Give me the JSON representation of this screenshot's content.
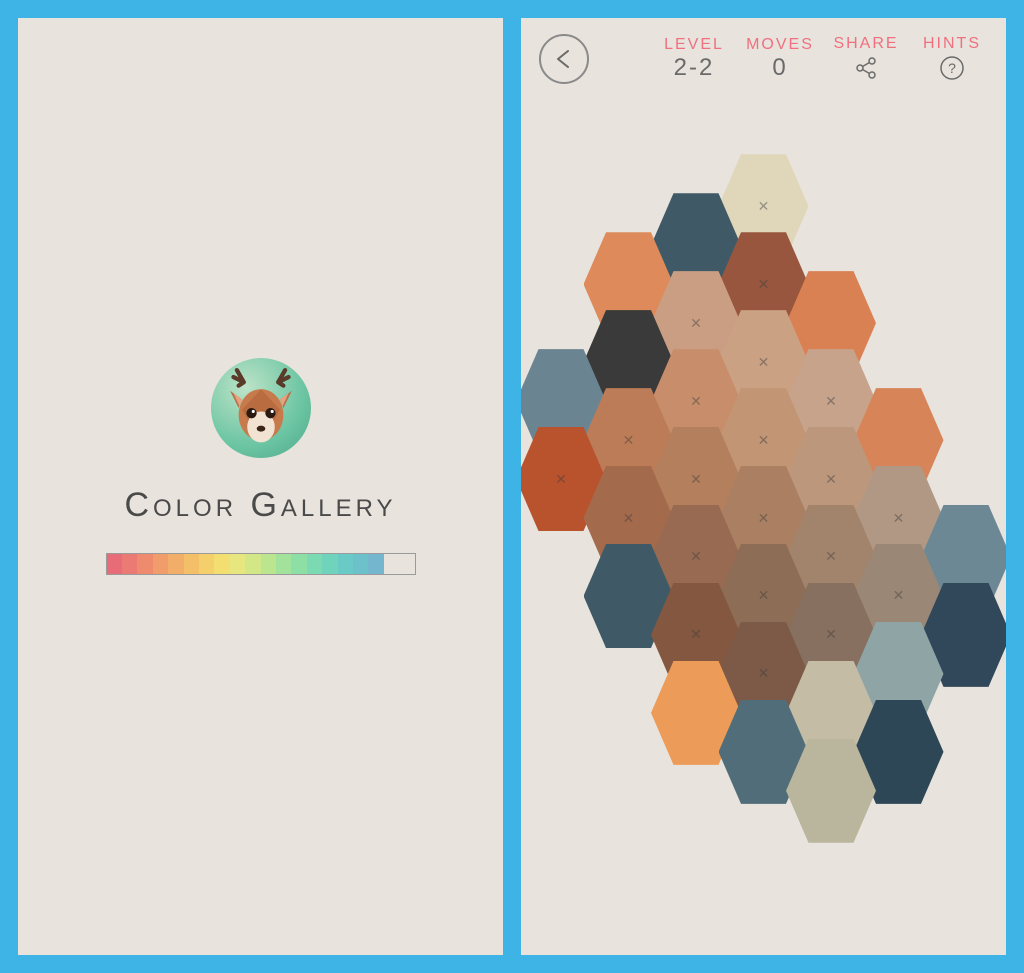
{
  "left": {
    "title": "Color Gallery",
    "avatar": "deer-icon",
    "progress_colors": [
      "#e86b78",
      "#ea7a73",
      "#ee8b6e",
      "#f09d6b",
      "#f2ae69",
      "#f4bf69",
      "#f5cf6b",
      "#f3de72",
      "#e8e67e",
      "#d3e786",
      "#bbe58f",
      "#a3e29a",
      "#8edfa6",
      "#7cdab2",
      "#70d4bd",
      "#6acbc6",
      "#6cc1cb",
      "#74b6cd",
      "#e8e3dc",
      "#e8e3dc"
    ]
  },
  "game": {
    "header": {
      "level_label": "LEVEL",
      "level_value": "2-2",
      "moves_label": "MOVES",
      "moves_value": "0",
      "share_label": "SHARE",
      "hints_label": "HINTS"
    },
    "hexes": [
      {
        "q": 0,
        "r": -4,
        "color": "#e0d7bb",
        "x": true
      },
      {
        "q": -1,
        "r": -3,
        "color": "#3f5a66",
        "x": false
      },
      {
        "q": 0,
        "r": -3,
        "color": "#97563d",
        "x": true
      },
      {
        "q": 1,
        "r": -3,
        "color": "#da8154",
        "x": false
      },
      {
        "q": -2,
        "r": -2,
        "color": "#de8a5a",
        "x": false
      },
      {
        "q": -1,
        "r": -2,
        "color": "#ca9e83",
        "x": true
      },
      {
        "q": 0,
        "r": -2,
        "color": "#cba184",
        "x": true
      },
      {
        "q": 1,
        "r": -2,
        "color": "#c7a38b",
        "x": true
      },
      {
        "q": 2,
        "r": -2,
        "color": "#d78458",
        "x": false
      },
      {
        "q": -2,
        "r": -1,
        "color": "#3a3a3a",
        "x": false
      },
      {
        "q": -1,
        "r": -1,
        "color": "#c88e6c",
        "x": true
      },
      {
        "q": 0,
        "r": -1,
        "color": "#c29574",
        "x": true
      },
      {
        "q": 1,
        "r": -1,
        "color": "#bc977c",
        "x": true
      },
      {
        "q": 2,
        "r": -1,
        "color": "#b09884",
        "x": true
      },
      {
        "q": 3,
        "r": -1,
        "color": "#6d8895",
        "x": false
      },
      {
        "q": -3,
        "r": 0,
        "color": "#6a8591",
        "x": false
      },
      {
        "q": -2,
        "r": 0,
        "color": "#bb7c57",
        "x": true
      },
      {
        "q": -1,
        "r": 0,
        "color": "#b47f5d",
        "x": true
      },
      {
        "q": 0,
        "r": 0,
        "color": "#ab8062",
        "x": true
      },
      {
        "q": 1,
        "r": 0,
        "color": "#a2836c",
        "x": true
      },
      {
        "q": 2,
        "r": 0,
        "color": "#9b8775",
        "x": true
      },
      {
        "q": 3,
        "r": 0,
        "color": "#31485a",
        "x": false
      },
      {
        "q": -3,
        "r": 1,
        "color": "#b9532e",
        "x": true
      },
      {
        "q": -2,
        "r": 1,
        "color": "#a46a4c",
        "x": true
      },
      {
        "q": -1,
        "r": 1,
        "color": "#986a51",
        "x": true
      },
      {
        "q": 0,
        "r": 1,
        "color": "#8e6d56",
        "x": true
      },
      {
        "q": 1,
        "r": 1,
        "color": "#87705f",
        "x": true
      },
      {
        "q": 2,
        "r": 1,
        "color": "#8fa4a5",
        "x": false
      },
      {
        "q": -2,
        "r": 2,
        "color": "#3f5a66",
        "x": false
      },
      {
        "q": -1,
        "r": 2,
        "color": "#835740",
        "x": true
      },
      {
        "q": 0,
        "r": 2,
        "color": "#7c5a47",
        "x": true
      },
      {
        "q": 1,
        "r": 2,
        "color": "#c4bca4",
        "x": false
      },
      {
        "q": 2,
        "r": 2,
        "color": "#2e4757",
        "x": false
      },
      {
        "q": -1,
        "r": 3,
        "color": "#ec9b59",
        "x": false
      },
      {
        "q": 0,
        "r": 3,
        "color": "#516d79",
        "x": false
      },
      {
        "q": 1,
        "r": 3,
        "color": "#b9b69d",
        "x": false
      }
    ]
  }
}
